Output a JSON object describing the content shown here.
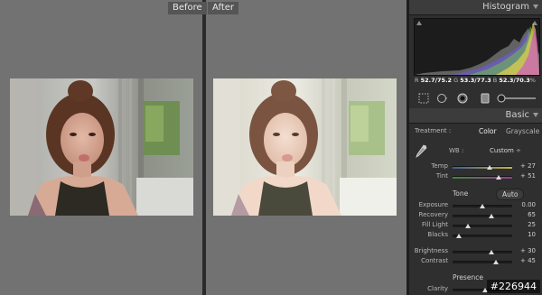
{
  "compare": {
    "before_label": "Before",
    "after_label": "After"
  },
  "histogram": {
    "title": "Histogram",
    "readout": {
      "r_label": "R",
      "r_value": "52.7/75.2",
      "g_label": "G",
      "g_value": "53.3/77.3",
      "b_label": "B",
      "b_value": "52.3/70.3",
      "unit": "%"
    }
  },
  "basic": {
    "title": "Basic",
    "treatment_label": "Treatment :",
    "treatment_color": "Color",
    "treatment_grayscale": "Grayscale",
    "wb_label": "WB :",
    "wb_value": "Custom",
    "wb_arrows": "÷",
    "temp_label": "Temp",
    "temp_value": "+ 27",
    "temp_level": 0.62,
    "tint_label": "Tint",
    "tint_value": "+ 51",
    "tint_level": 0.78,
    "tone_label": "Tone",
    "auto_label": "Auto",
    "exposure_label": "Exposure",
    "exposure_value": "0.00",
    "exposure_level": 0.5,
    "recovery_label": "Recovery",
    "recovery_value": "65",
    "recovery_level": 0.65,
    "filllight_label": "Fill Light",
    "filllight_value": "25",
    "filllight_level": 0.25,
    "blacks_label": "Blacks",
    "blacks_value": "10",
    "blacks_level": 0.1,
    "brightness_label": "Brightness",
    "brightness_value": "+ 30",
    "brightness_level": 0.65,
    "contrast_label": "Contrast",
    "contrast_value": "+ 45",
    "contrast_level": 0.72,
    "presence_label": "Presence",
    "clarity_label": "Clarity",
    "clarity_level": 0.55
  },
  "watermark": "#226944",
  "colors": {
    "accent_white": "#dcdcdc",
    "temp_track_blue": "#3b5b9a",
    "temp_track_yellow": "#c9b23a",
    "tint_track_green": "#3c8a3c",
    "tint_track_magenta": "#9a3a9a"
  }
}
